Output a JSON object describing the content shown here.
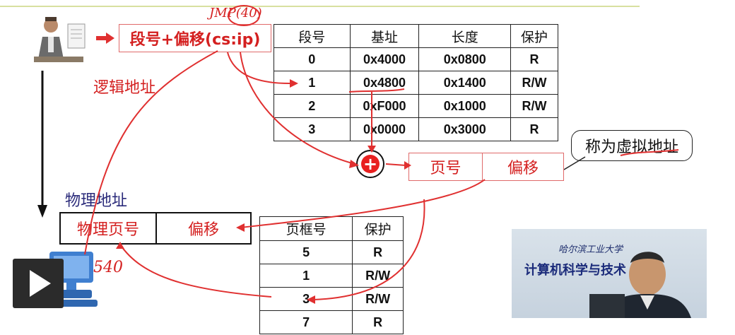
{
  "logical": {
    "box_label": "段号+偏移(cs:ip)",
    "caption": "逻辑地址"
  },
  "segment_table": {
    "headers": [
      "段号",
      "基址",
      "长度",
      "保护"
    ],
    "rows": [
      [
        "0",
        "0x4000",
        "0x0800",
        "R"
      ],
      [
        "1",
        "0x4800",
        "0x1400",
        "R/W"
      ],
      [
        "2",
        "0xF000",
        "0x1000",
        "R/W"
      ],
      [
        "3",
        "0x0000",
        "0x3000",
        "R"
      ]
    ]
  },
  "virtual": {
    "page_label": "页号",
    "offset_label": "偏移",
    "callout": "称为虚拟地址",
    "plus": "+"
  },
  "physical": {
    "caption": "物理地址",
    "frame_label": "物理页号",
    "offset_label": "偏移"
  },
  "page_table": {
    "headers": [
      "页框号",
      "保护"
    ],
    "rows": [
      [
        "5",
        "R"
      ],
      [
        "1",
        "R/W"
      ],
      [
        "3",
        "R/W"
      ],
      [
        "7",
        "R"
      ]
    ]
  },
  "annotations": {
    "jmp": "JMP(40)",
    "num540": "540"
  },
  "video": {
    "banner_top": "哈尔滨工业大学",
    "banner_main": "计算机科学与技术"
  },
  "colors": {
    "accent": "#d42020",
    "arrow": "#e03030"
  }
}
